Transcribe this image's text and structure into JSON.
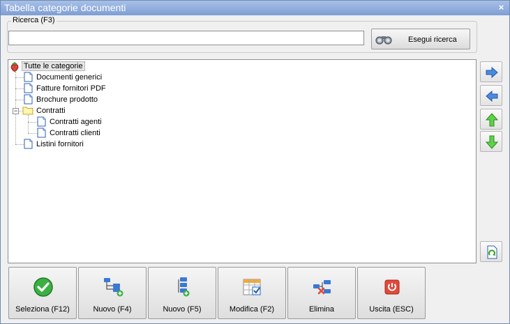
{
  "window": {
    "title": "Tabella categorie documenti",
    "close_glyph": "×"
  },
  "search": {
    "group_label": "Ricerca (F3)",
    "value": "",
    "placeholder": "",
    "button_label": "Esegui ricerca",
    "button_icon": "binoculars-icon"
  },
  "tree": {
    "root": "Tutte le categorie",
    "items": [
      {
        "label": "Documenti generici",
        "icon": "document-icon"
      },
      {
        "label": "Fatture fornitori PDF",
        "icon": "document-icon"
      },
      {
        "label": "Brochure prodotto",
        "icon": "document-icon"
      },
      {
        "label": "Contratti",
        "icon": "folder-icon",
        "expander": "−",
        "children": [
          {
            "label": "Contratti agenti",
            "icon": "document-icon"
          },
          {
            "label": "Contratti clienti",
            "icon": "document-icon"
          }
        ]
      },
      {
        "label": "Listini fornitori",
        "icon": "document-icon"
      }
    ]
  },
  "side_buttons": [
    "arrow-right-icon",
    "arrow-left-icon",
    "arrow-up-icon",
    "arrow-down-icon",
    "refresh-document-icon"
  ],
  "buttons": {
    "select": "Seleziona (F12)",
    "new_f4": "Nuovo (F4)",
    "new_f5": "Nuovo (F5)",
    "edit": "Modifica (F2)",
    "delete": "Elimina",
    "exit": "Uscita (ESC)"
  },
  "colors": {
    "titlebar": "#7e9ed4",
    "accent_green": "#3cb043",
    "accent_blue": "#3a78d4",
    "exit_red": "#e04a3a"
  }
}
